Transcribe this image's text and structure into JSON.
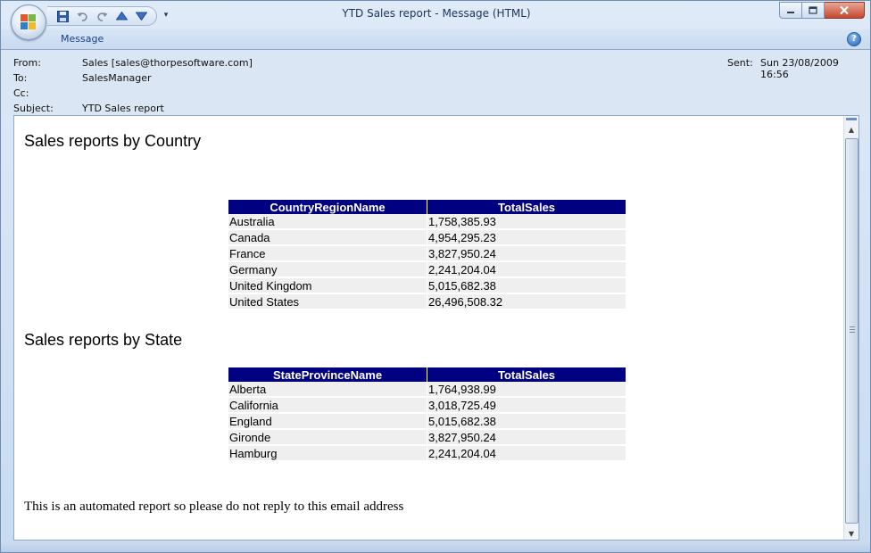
{
  "window": {
    "title": "YTD Sales report - Message (HTML)"
  },
  "ribbon": {
    "tab_message": "Message",
    "help_glyph": "?"
  },
  "header": {
    "from_label": "From:",
    "from_value": "Sales [sales@thorpesoftware.com]",
    "to_label": "To:",
    "to_value": "SalesManager",
    "cc_label": "Cc:",
    "cc_value": "",
    "subject_label": "Subject:",
    "subject_value": "YTD Sales report",
    "sent_label": "Sent:",
    "sent_value": "Sun 23/08/2009 16:56"
  },
  "body": {
    "country_heading": "Sales reports by Country",
    "country_table": {
      "headers": [
        "CountryRegionName",
        "TotalSales"
      ],
      "rows": [
        [
          "Australia",
          "1,758,385.93"
        ],
        [
          "Canada",
          "4,954,295.23"
        ],
        [
          "France",
          "3,827,950.24"
        ],
        [
          "Germany",
          "2,241,204.04"
        ],
        [
          "United Kingdom",
          "5,015,682.38"
        ],
        [
          "United States",
          "26,496,508.32"
        ]
      ]
    },
    "state_heading": "Sales reports by State",
    "state_table": {
      "headers": [
        "StateProvinceName",
        "TotalSales"
      ],
      "rows": [
        [
          "Alberta",
          "1,764,938.99"
        ],
        [
          "California",
          "3,018,725.49"
        ],
        [
          "England",
          "5,015,682.38"
        ],
        [
          "Gironde",
          "3,827,950.24"
        ],
        [
          "Hamburg",
          "2,241,204.04"
        ]
      ]
    },
    "footer_note": "This is an automated report so please do not reply to this email address"
  },
  "colors": {
    "table_header_bg": "#000080",
    "row_bg": "#efefef",
    "frame": "#c8dbf1"
  },
  "icons": [
    "office-button-icon",
    "save-icon",
    "undo-icon",
    "redo-icon",
    "previous-item-icon",
    "next-item-icon",
    "customize-toolbar-icon",
    "minimize-icon",
    "maximize-icon",
    "close-icon",
    "help-icon"
  ]
}
